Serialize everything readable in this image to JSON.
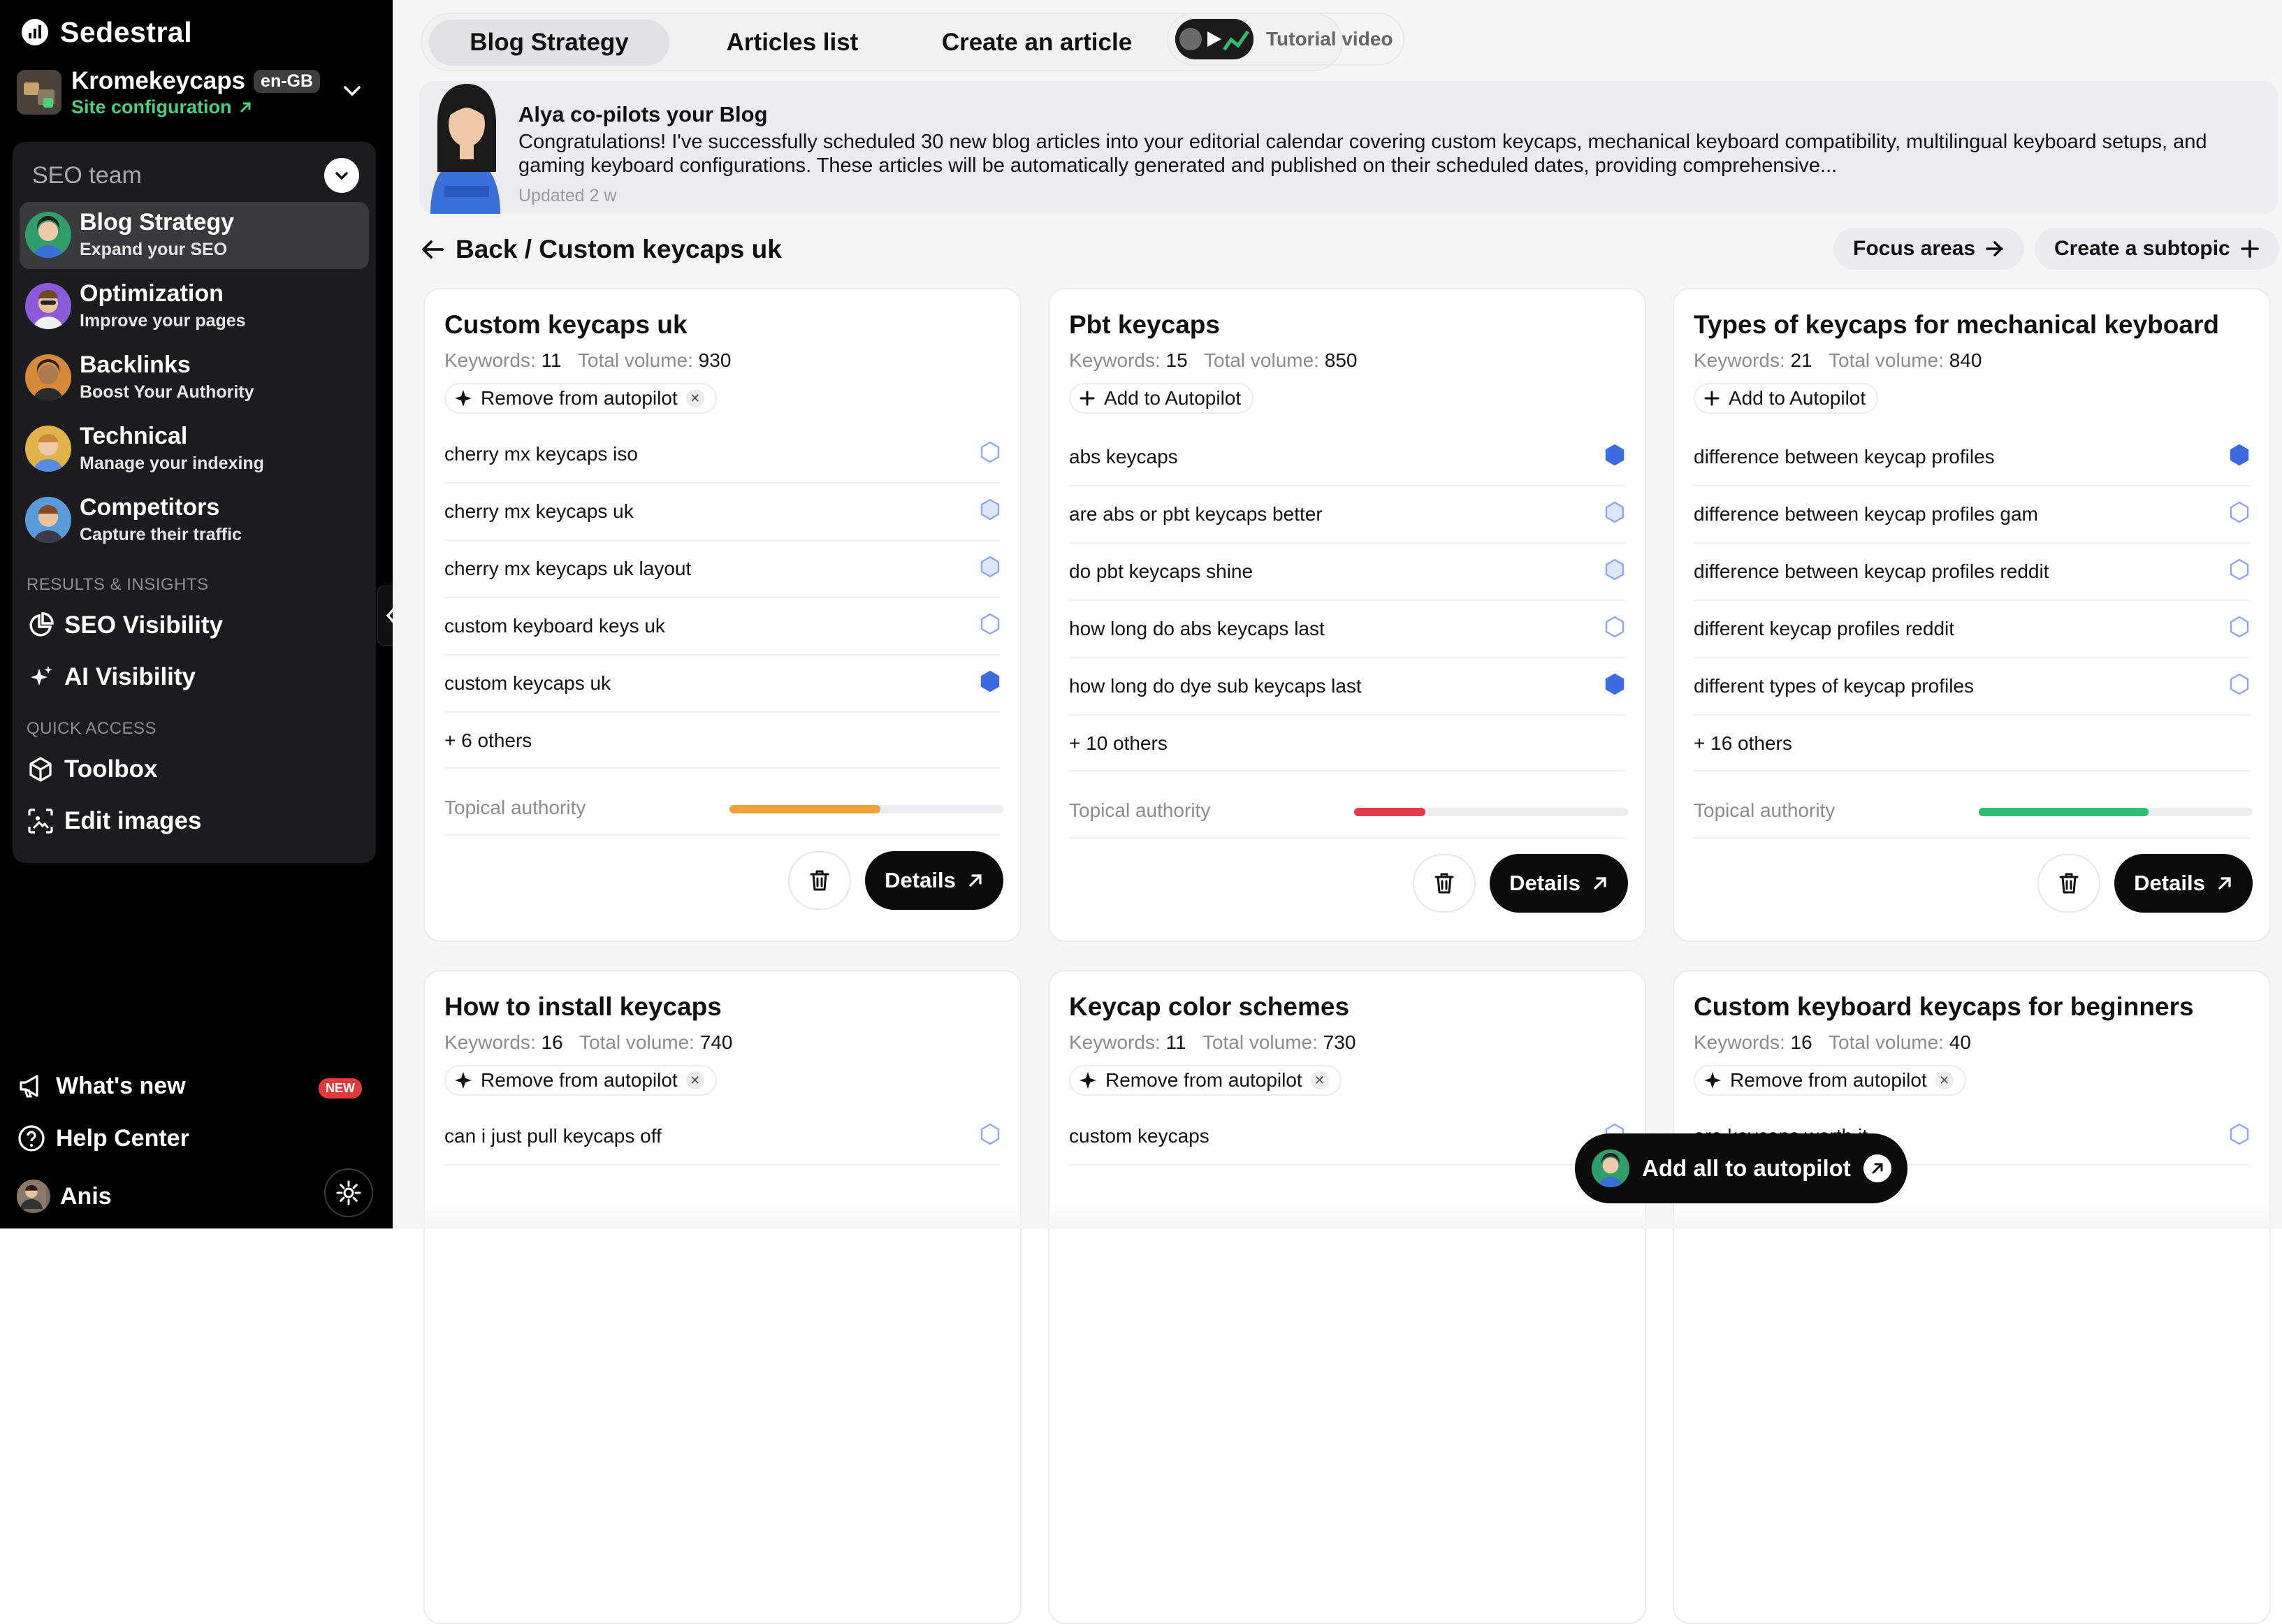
{
  "brand": {
    "name": "Sedestral"
  },
  "site": {
    "name": "Kromekeycaps",
    "lang": "en-GB",
    "config_label": "Site configuration"
  },
  "team": {
    "title": "SEO team",
    "items": [
      {
        "title": "Blog Strategy",
        "subtitle": "Expand your SEO"
      },
      {
        "title": "Optimization",
        "subtitle": "Improve your pages"
      },
      {
        "title": "Backlinks",
        "subtitle": "Boost Your Authority"
      },
      {
        "title": "Technical",
        "subtitle": "Manage your indexing"
      },
      {
        "title": "Competitors",
        "subtitle": "Capture their traffic"
      }
    ],
    "results_heading": "RESULTS & INSIGHTS",
    "results": [
      "SEO Visibility",
      "AI Visibility"
    ],
    "quick_heading": "QUICK ACCESS",
    "quick": [
      "Toolbox",
      "Edit images"
    ]
  },
  "bottom": {
    "whats_new": "What's new",
    "new_badge": "NEW",
    "help": "Help Center",
    "user": "Anis"
  },
  "tabs": [
    "Blog Strategy",
    "Articles list",
    "Create an article"
  ],
  "tutorial_label": "Tutorial video",
  "alya": {
    "title": "Alya co-pilots your Blog",
    "text": "Congratulations! I've successfully scheduled 30 new blog articles into your editorial calendar covering custom keycaps, mechanical keyboard compatibility, multilingual keyboard setups, and gaming keyboard configurations. These articles will be automatically generated and published on their scheduled dates, providing comprehensive...",
    "updated": "Updated 2 w"
  },
  "breadcrumb": "Back / Custom keycaps uk",
  "focus_areas": "Focus areas",
  "create_subtopic": "Create a subtopic",
  "labels": {
    "keywords": "Keywords:",
    "total_volume": "Total volume:",
    "topical_authority": "Topical authority",
    "details": "Details",
    "remove_autopilot": "Remove from autopilot",
    "add_autopilot": "Add to Autopilot"
  },
  "colors": {
    "accent_blue": "#3d6ae0",
    "orange": "#f0a23a",
    "red": "#e23a4a",
    "green": "#2ebd72"
  },
  "cards": [
    {
      "title": "Custom keycaps uk",
      "keywords": "11",
      "volume": "930",
      "autopilot": "remove",
      "items": [
        {
          "text": "cherry mx keycaps iso",
          "state": "empty"
        },
        {
          "text": "cherry mx keycaps uk",
          "state": "light"
        },
        {
          "text": "cherry mx keycaps uk layout",
          "state": "light"
        },
        {
          "text": "custom keyboard keys uk",
          "state": "empty"
        },
        {
          "text": "custom keycaps uk",
          "state": "filled"
        }
      ],
      "others": "+ 6 others",
      "authority": 0.55,
      "authority_color": "orange"
    },
    {
      "title": "Pbt keycaps",
      "keywords": "15",
      "volume": "850",
      "autopilot": "add",
      "items": [
        {
          "text": "abs keycaps",
          "state": "filled"
        },
        {
          "text": "are abs or pbt keycaps better",
          "state": "light"
        },
        {
          "text": "do pbt keycaps shine",
          "state": "light"
        },
        {
          "text": "how long do abs keycaps last",
          "state": "empty"
        },
        {
          "text": "how long do dye sub keycaps last",
          "state": "filled"
        }
      ],
      "others": "+ 10 others",
      "authority": 0.26,
      "authority_color": "red"
    },
    {
      "title": "Types of keycaps for mechanical keyboard",
      "keywords": "21",
      "volume": "840",
      "autopilot": "add",
      "items": [
        {
          "text": "difference between keycap profiles",
          "state": "filled"
        },
        {
          "text": "difference between keycap profiles gam",
          "state": "empty"
        },
        {
          "text": "difference between keycap profiles reddit",
          "state": "empty"
        },
        {
          "text": "different keycap profiles reddit",
          "state": "empty"
        },
        {
          "text": "different types of keycap profiles",
          "state": "empty"
        }
      ],
      "others": "+ 16 others",
      "authority": 0.62,
      "authority_color": "green"
    },
    {
      "title": "How to install keycaps",
      "keywords": "16",
      "volume": "740",
      "autopilot": "remove",
      "items": [
        {
          "text": "can i just pull keycaps off",
          "state": "empty"
        }
      ]
    },
    {
      "title": "Keycap color schemes",
      "keywords": "11",
      "volume": "730",
      "autopilot": "remove",
      "items": [
        {
          "text": "custom keycaps",
          "state": "empty"
        }
      ]
    },
    {
      "title": "Custom keyboard keycaps for beginners",
      "keywords": "16",
      "volume": "40",
      "autopilot": "remove",
      "items": [
        {
          "text": "are keycaps worth it",
          "state": "empty"
        }
      ]
    }
  ],
  "fab_label": "Add all to autopilot"
}
